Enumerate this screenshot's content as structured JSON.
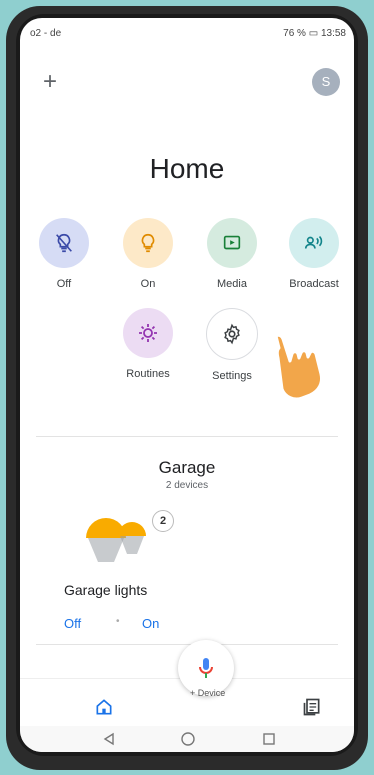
{
  "status_bar": {
    "carrier": "o2 - de",
    "right_text": "76 %",
    "time": "13:58"
  },
  "header": {
    "avatar_letter": "S",
    "title": "Home"
  },
  "actions": [
    {
      "label": "Off",
      "icon": "bulb-off-icon",
      "color": "#d6dcf5"
    },
    {
      "label": "On",
      "icon": "bulb-icon",
      "color": "#fde9c8"
    },
    {
      "label": "Media",
      "icon": "media-icon",
      "color": "#d5ebdf"
    },
    {
      "label": "Broadcast",
      "icon": "broadcast-icon",
      "color": "#d2eeee"
    },
    {
      "label": "Routines",
      "icon": "routines-icon",
      "color": "#ecdcf3"
    },
    {
      "label": "Settings",
      "icon": "gear-icon",
      "color": "#ffffff"
    }
  ],
  "room": {
    "name": "Garage",
    "device_count": "2 devices",
    "device": {
      "name": "Garage lights",
      "badge": "2",
      "off_label": "Off",
      "on_label": "On"
    }
  },
  "fab": {
    "icon": "mic-icon",
    "label": "+ Device"
  },
  "nav": {
    "home_icon": "home-icon",
    "feed_icon": "feed-icon"
  }
}
